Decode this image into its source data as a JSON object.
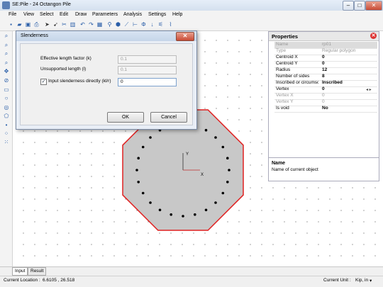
{
  "window": {
    "title": "SE:Pile - 24 Octangon Pile"
  },
  "menu": [
    "File",
    "View",
    "Select",
    "Edit",
    "Draw",
    "Parameters",
    "Analysis",
    "Settings",
    "Help"
  ],
  "toolbar_icons": [
    "new-icon",
    "open-icon",
    "save-icon",
    "print-icon",
    "select-icon",
    "select-node-icon",
    "cut-icon",
    "delete-icon",
    "undo-icon",
    "redo-icon",
    "calc-icon",
    "tree-icon",
    "pile-icon",
    "line-icon",
    "dimension-icon",
    "phi-icon",
    "down-arrow-icon",
    "result-icon",
    "chart-icon"
  ],
  "left_tools": [
    "zoom-in-icon",
    "zoom-out-icon",
    "zoom-window-icon",
    "zoom-extent-icon",
    "pan-icon",
    "point-icon",
    "line-icon",
    "rect-icon",
    "circle-icon",
    "polygon-icon",
    "dot-icon",
    "ring-icon",
    "grid-icon"
  ],
  "dialog": {
    "title": "Slenderness",
    "close": "✕",
    "effective_label": "Effective length factor (k)",
    "effective_value": "0.1",
    "unsupported_label": "Unsupported length (l)",
    "unsupported_value": "0.1",
    "checkbox_label": "Input slenderness directly (kl/r)",
    "slenderness_value": "0",
    "ok": "OK",
    "cancel": "Cancel"
  },
  "properties": {
    "title": "Properties",
    "rows": [
      {
        "key": "Name",
        "value": "rp01",
        "dim": true
      },
      {
        "key": "Type",
        "value": "Regular polygon",
        "dim": true
      },
      {
        "key": "Centroid  X",
        "value": "0",
        "dim": false
      },
      {
        "key": "Centroid  Y",
        "value": "0",
        "dim": false
      },
      {
        "key": "Radius",
        "value": "12",
        "dim": false
      },
      {
        "key": "Number of sides",
        "value": "8",
        "dim": false
      },
      {
        "key": "Inscribed or circumsc",
        "value": "Inscribed",
        "dim": false
      },
      {
        "key": "Vertex",
        "value": "0",
        "dim": false
      },
      {
        "key": "Vertex X",
        "value": "0",
        "dim": true
      },
      {
        "key": "Vertex Y",
        "value": "0",
        "dim": true
      },
      {
        "key": "Is void",
        "value": "No",
        "dim": false
      }
    ],
    "help_title": "Name",
    "help_text": "Name of current object"
  },
  "canvas": {
    "axis_x": "X",
    "axis_y": "Y"
  },
  "tabs": [
    "Input",
    "Result"
  ],
  "status": {
    "location_label": "Current Location :",
    "location_value": "6.6105 , 26.518",
    "unit_label": "Current Unit :",
    "unit_value": "Kip, in"
  },
  "colors": {
    "section_fill": "#c8c8c8",
    "section_edge": "#e02020",
    "accent": "#2a5ea8"
  }
}
